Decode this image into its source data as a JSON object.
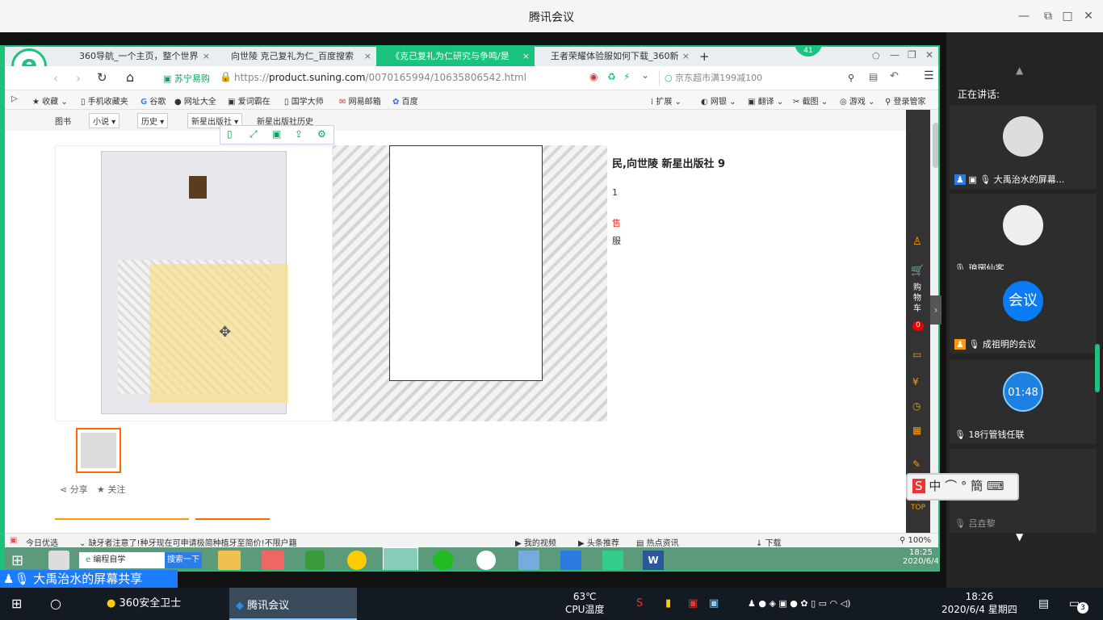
{
  "window": {
    "title": "腾讯会议"
  },
  "browser": {
    "badge": "41",
    "tabs": [
      "360导航_一个主页，整个世界",
      "向世陵 克己复礼为仁_百度搜索",
      "《克己复礼为仁研究与争鸣/是",
      "王者荣耀体验服如何下载_360新"
    ],
    "site_name": "苏宁易购",
    "url_prefix": "https://",
    "url_domain": "product.suning.com",
    "url_path": "/0070165994/10635806542.html",
    "search_placeholder": "京东超市满199减100",
    "favorites": [
      "收藏",
      "手机收藏夹",
      "谷歌",
      "网址大全",
      "爱词霸在",
      "国学大师",
      "网易邮箱",
      "百度"
    ],
    "tools": [
      "扩展",
      "网银",
      "翻译",
      "截图",
      "游戏",
      "登录管家"
    ]
  },
  "page": {
    "breadcrumb": [
      "图书",
      "小说",
      "历史",
      "新星出版社",
      "新星出版社历史"
    ],
    "title_partial": "民,向世陵 新星出版社 9",
    "side_texts": [
      "1",
      "售",
      "服"
    ],
    "share": "分享",
    "follow": "关注",
    "cart": [
      "购",
      "物",
      "车"
    ],
    "cart_count": "0",
    "top_label": "TOP"
  },
  "status": {
    "left": "今日优选",
    "news": "缺牙者注意了!种牙现在可申请极简种植牙至简价!不限户籍",
    "items": [
      "我的视频",
      "头条推荐",
      "热点资讯",
      "下载"
    ],
    "zoom": "100%"
  },
  "inner_taskbar": {
    "search_text": "编程自学",
    "search_button": "搜索一下",
    "time": "18:25",
    "date": "2020/6/4"
  },
  "sharer_label": "大禹治水的屏幕共享",
  "side": {
    "speaking": "正在讲话:",
    "participants": [
      {
        "name": "大禹治水的屏幕..."
      },
      {
        "name": "琅琊仙客"
      },
      {
        "name": "成祖明的会议",
        "avatar_text": "会议"
      },
      {
        "name": "18行管钱任联",
        "avatar_text": "01:48"
      },
      {
        "name": "吕垚黎"
      }
    ],
    "ime": "中"
  },
  "taskbar": {
    "apps": [
      "360安全卫士",
      "腾讯会议"
    ],
    "temp": "63℃",
    "temp_label": "CPU温度",
    "time": "18:26",
    "date": "2020/6/4 星期四",
    "notif": "3"
  },
  "colors": {
    "accent": "#19c27d",
    "meeting_blue": "#1b7cff"
  }
}
